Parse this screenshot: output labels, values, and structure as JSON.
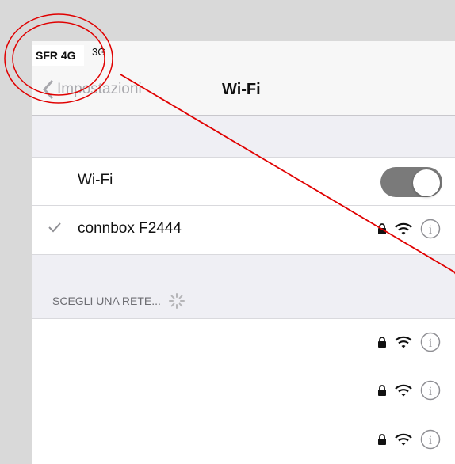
{
  "statusbar": {
    "carrier": "SFR 4G",
    "network": "3G"
  },
  "navbar": {
    "back_label": "Impostazioni",
    "title": "Wi-Fi"
  },
  "wifi_toggle": {
    "label": "Wi-Fi",
    "on": true
  },
  "connected_network": {
    "name": "connbox F2444"
  },
  "section": {
    "header": "SCEGLI UNA RETE..."
  },
  "networks": [
    {
      "name": ""
    },
    {
      "name": ""
    },
    {
      "name": ""
    }
  ],
  "colors": {
    "accent": "#8e8e93",
    "annotation": "#e00000"
  }
}
